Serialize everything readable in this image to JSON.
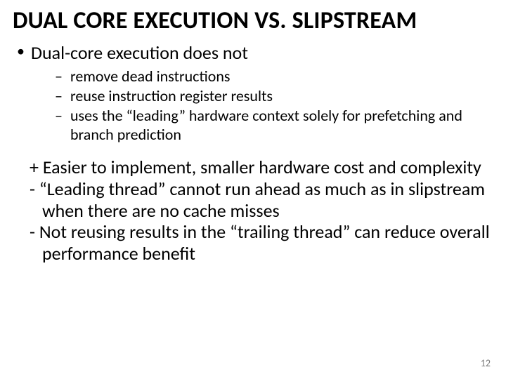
{
  "title": "DUAL CORE EXECUTION VS. SLIPSTREAM",
  "bullet1": {
    "text": "Dual-core execution does not",
    "subs": [
      "remove dead instructions",
      "reuse instruction register results",
      "uses the “leading” hardware context solely for prefetching and branch prediction"
    ]
  },
  "plain": [
    "+ Easier to implement, smaller hardware cost and complexity",
    "- “Leading thread” cannot run ahead as much as in slipstream when there are no cache misses",
    "- Not reusing results in the “trailing thread” can reduce overall performance benefit"
  ],
  "page_number": "12"
}
